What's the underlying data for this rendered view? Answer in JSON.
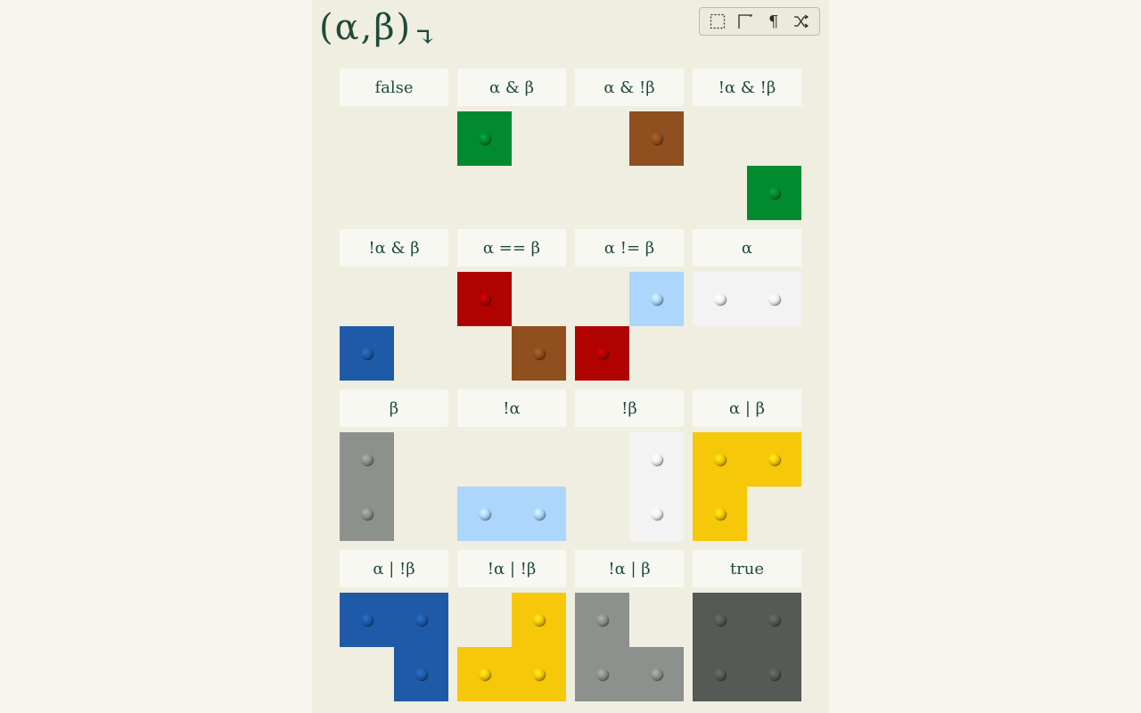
{
  "title": {
    "text": "(α,β)",
    "arrow": "↴"
  },
  "toolbar": {
    "tools": [
      {
        "name": "selection-icon"
      },
      {
        "name": "corner-icon"
      },
      {
        "name": "pilcrow-icon",
        "glyph": "¶"
      },
      {
        "name": "shuffle-icon"
      }
    ]
  },
  "colors": {
    "green": "#028a2f",
    "brown": "#8f4f1e",
    "red": "#b10202",
    "light_blue": "#acd6fb",
    "white": "#f3f3f3",
    "grey": "#8c918d",
    "blue": "#1f5aa8",
    "yellow": "#f7c70a",
    "dark_grey": "#555a56"
  },
  "cells": [
    {
      "label": "false",
      "color": "green",
      "filled": [
        0,
        0,
        0,
        0
      ]
    },
    {
      "label": "α & β",
      "color": "green",
      "filled": [
        1,
        0,
        0,
        0
      ]
    },
    {
      "label": "α & !β",
      "color": "brown",
      "filled": [
        0,
        1,
        0,
        0
      ]
    },
    {
      "label": "!α & !β",
      "color": "green",
      "filled": [
        0,
        0,
        0,
        1
      ]
    },
    {
      "label": "!α & β",
      "color": "blue",
      "filled": [
        0,
        0,
        1,
        0
      ]
    },
    {
      "label": "α == β",
      "color": "red",
      "filled": [
        1,
        0,
        0,
        0
      ],
      "second_color": "brown",
      "second_filled": [
        0,
        0,
        0,
        1
      ]
    },
    {
      "label": "α != β",
      "color": "light_blue",
      "filled": [
        0,
        1,
        0,
        0
      ],
      "second_color": "red",
      "second_filled": [
        0,
        0,
        1,
        0
      ]
    },
    {
      "label": "α",
      "color": "white",
      "filled": [
        1,
        1,
        0,
        0
      ]
    },
    {
      "label": "β",
      "color": "grey",
      "filled": [
        1,
        0,
        1,
        0
      ]
    },
    {
      "label": "!α",
      "color": "light_blue",
      "filled": [
        0,
        0,
        1,
        1
      ]
    },
    {
      "label": "!β",
      "color": "white",
      "filled": [
        0,
        1,
        0,
        1
      ]
    },
    {
      "label": "α | β",
      "color": "yellow",
      "filled": [
        1,
        1,
        1,
        0
      ]
    },
    {
      "label": "α | !β",
      "color": "blue",
      "filled": [
        1,
        1,
        0,
        1
      ]
    },
    {
      "label": "!α | !β",
      "color": "yellow",
      "filled": [
        0,
        1,
        1,
        1
      ]
    },
    {
      "label": "!α | β",
      "color": "grey",
      "filled": [
        1,
        0,
        1,
        1
      ]
    },
    {
      "label": "true",
      "color": "dark_grey",
      "filled": [
        1,
        1,
        1,
        1
      ]
    }
  ]
}
